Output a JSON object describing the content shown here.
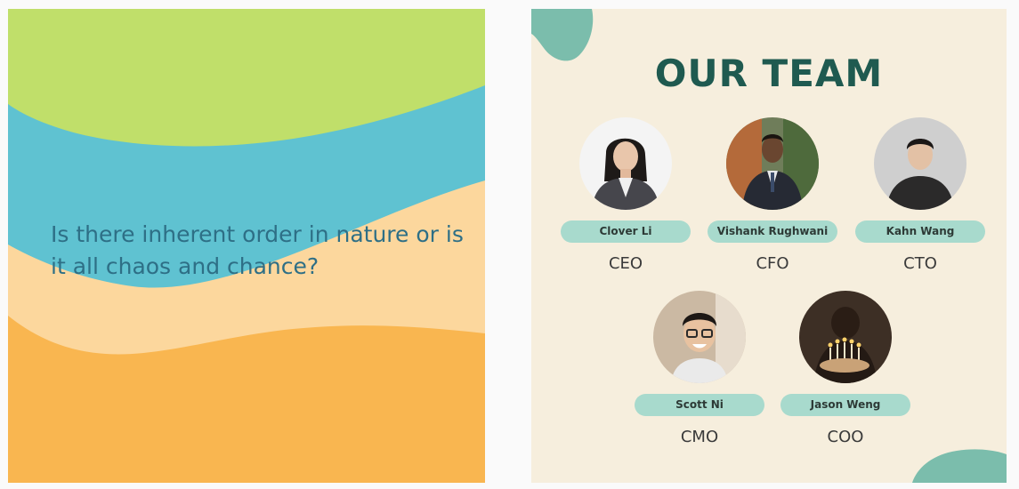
{
  "slides": {
    "left": {
      "question": "Is there inherent order in nature or is it all chaos and chance?",
      "colors": {
        "green": "#c0df6a",
        "blue": "#5fc2d1",
        "sand": "#fcd79d",
        "orange": "#f9b650",
        "text": "#2e6f86"
      }
    },
    "right": {
      "title": "OUR TEAM",
      "colors": {
        "background": "#f6eedd",
        "title": "#1f5a50",
        "pill": "#a8dacd",
        "blob": "#7bbdac"
      },
      "members": [
        {
          "name": "Clover Li",
          "role": "CEO",
          "photo": "portrait-woman-office-icon"
        },
        {
          "name": "Vishank Rughwani",
          "role": "CFO",
          "photo": "portrait-man-outdoor-icon"
        },
        {
          "name": "Kahn Wang",
          "role": "CTO",
          "photo": "portrait-man-studio-icon"
        },
        {
          "name": "Scott Ni",
          "role": "CMO",
          "photo": "portrait-smiling-man-glasses-icon"
        },
        {
          "name": "Jason Weng",
          "role": "COO",
          "photo": "birthday-candles-portrait-icon"
        }
      ]
    }
  }
}
